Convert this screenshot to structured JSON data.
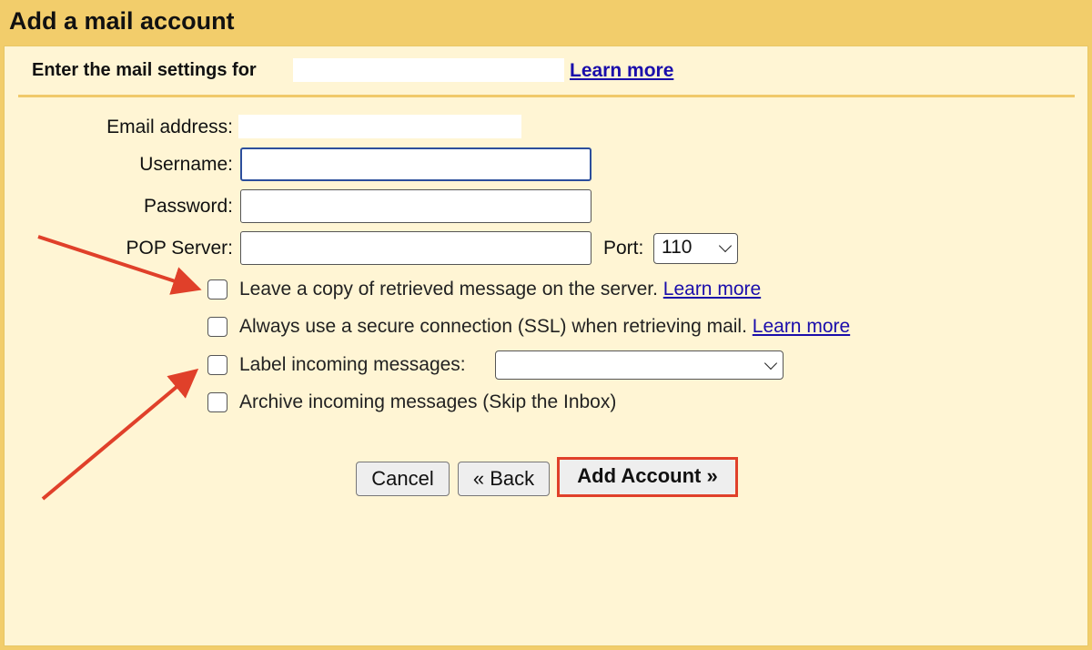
{
  "dialog": {
    "title": "Add a mail account"
  },
  "header": {
    "prompt": "Enter the mail settings for",
    "learn_more": "Learn more"
  },
  "form": {
    "email_label": "Email address:",
    "username_label": "Username:",
    "username_value": "",
    "password_label": "Password:",
    "password_value": "",
    "pop_label": "POP Server:",
    "pop_value": "",
    "port_label": "Port:",
    "port_value": "110"
  },
  "options": [
    {
      "label": "Leave a copy of retrieved message on the server.",
      "link": "Learn more",
      "checked": false
    },
    {
      "label": "Always use a secure connection (SSL) when retrieving mail.",
      "link": "Learn more",
      "checked": false
    },
    {
      "label": "Label incoming messages:",
      "checked": false
    },
    {
      "label": "Archive incoming messages (Skip the Inbox)",
      "checked": false
    }
  ],
  "buttons": {
    "cancel": "Cancel",
    "back": "« Back",
    "add": "Add Account »"
  },
  "colors": {
    "header": "#f2cd6b",
    "panel": "#fff5d4",
    "annotation": "#e0402a",
    "link": "#1a0dab"
  }
}
